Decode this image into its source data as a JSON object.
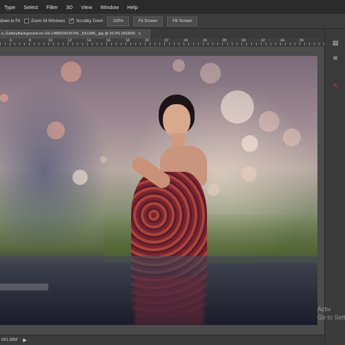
{
  "menu": {
    "items": [
      "Type",
      "Select",
      "Filter",
      "3D",
      "View",
      "Window",
      "Help"
    ]
  },
  "options": {
    "resize_windows_label": "dows to Fit",
    "zoom_all_windows_label": "Zoom All Windows",
    "zoom_all_windows_checked": false,
    "scrubby_zoom_label": "Scrubby Zoom",
    "scrubby_zoom_checked": true,
    "zoom_100_label": "100%",
    "fit_screen_label": "Fit Screen",
    "fill_screen_label": "Fill Screen"
  },
  "document": {
    "tab_title": "e_GalleryBackground-en-US-1488324326765._SX1080_.jpg @ 93.4% (RGB/8)",
    "close_glyph": "×"
  },
  "ruler": {
    "labels": [
      "6",
      "8",
      "10",
      "12",
      "14",
      "16",
      "18",
      "20",
      "22",
      "24",
      "26",
      "28",
      "30",
      "32",
      "34",
      "36"
    ]
  },
  "status": {
    "doc_size": "M/1.88M",
    "arrow_glyph": "▶"
  },
  "watermark": {
    "line1": "Activ",
    "line2": "Go to Settin"
  },
  "icons": {
    "right_panel": [
      "history-icon",
      "layers-icon",
      "brush-icon"
    ]
  },
  "colors": {
    "menubar_bg": "#2b2b2b",
    "options_bg": "#3c3c3c",
    "workspace_bg": "#4b4b4b",
    "accent_red": "#d23a3a"
  }
}
